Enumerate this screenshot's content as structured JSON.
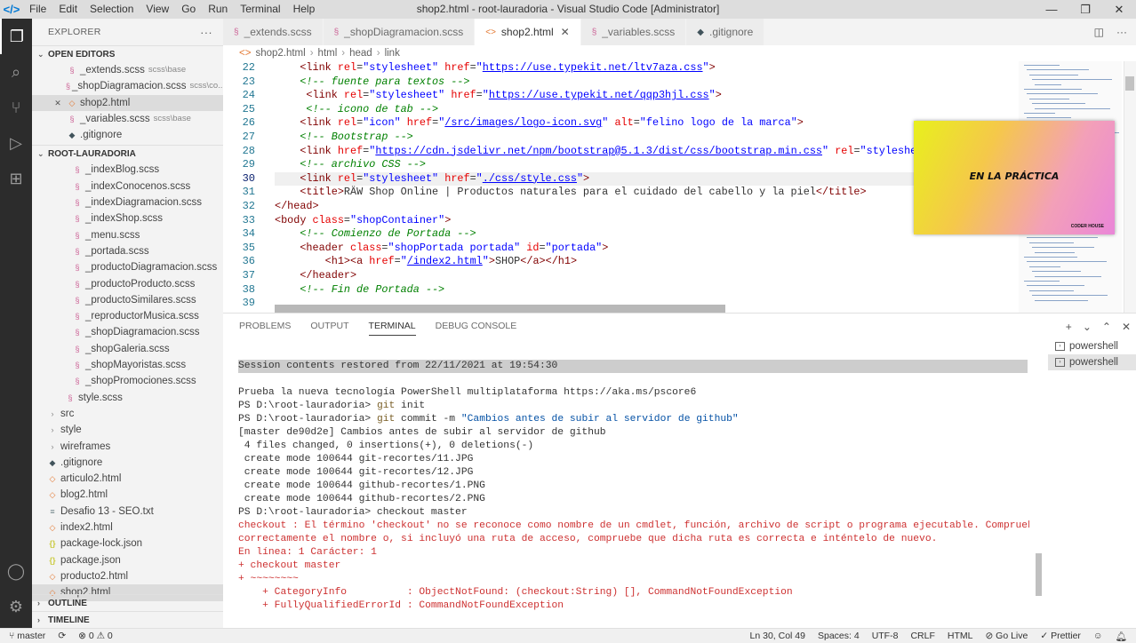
{
  "titlebar": {
    "menu": [
      "File",
      "Edit",
      "Selection",
      "View",
      "Go",
      "Run",
      "Terminal",
      "Help"
    ],
    "title": "shop2.html - root-lauradoria - Visual Studio Code [Administrator]"
  },
  "sidebar": {
    "title": "EXPLORER",
    "open_editors_label": "OPEN EDITORS",
    "open_editors": [
      {
        "name": "_extends.scss",
        "hint": "scss\\base"
      },
      {
        "name": "_shopDiagramacion.scss",
        "hint": "scss\\co..."
      },
      {
        "name": "shop2.html",
        "hint": ""
      },
      {
        "name": "_variables.scss",
        "hint": "scss\\base"
      },
      {
        "name": ".gitignore",
        "hint": ""
      }
    ],
    "root_label": "ROOT-LAURADORIA",
    "files": [
      "_indexBlog.scss",
      "_indexConocenos.scss",
      "_indexDiagramacion.scss",
      "_indexShop.scss",
      "_menu.scss",
      "_portada.scss",
      "_productoDiagramacion.scss",
      "_productoProducto.scss",
      "_productoSimilares.scss",
      "_reproductorMusica.scss",
      "_shopDiagramacion.scss",
      "_shopGaleria.scss",
      "_shopMayoristas.scss",
      "_shopPromociones.scss",
      "style.scss",
      "src",
      "style",
      "wireframes",
      ".gitignore",
      "articulo2.html",
      "blog2.html",
      "Desafio 13 - SEO.txt",
      "index2.html",
      "package-lock.json",
      "package.json",
      "producto2.html",
      "shop2.html"
    ],
    "outline_label": "OUTLINE",
    "timeline_label": "TIMELINE"
  },
  "tabs": [
    {
      "label": "_extends.scss"
    },
    {
      "label": "_shopDiagramacion.scss"
    },
    {
      "label": "shop2.html"
    },
    {
      "label": "_variables.scss"
    },
    {
      "label": ".gitignore"
    }
  ],
  "breadcrumb": [
    "shop2.html",
    "html",
    "head",
    "link"
  ],
  "editor": {
    "line_numbers": [
      "22",
      "23",
      "24",
      "25",
      "26",
      "27",
      "28",
      "29",
      "30",
      "31",
      "32",
      "33",
      "34",
      "35",
      "36",
      "37",
      "38",
      "39"
    ],
    "lines": [
      "    <link rel=\"stylesheet\" href=\"https://use.typekit.net/ltv7aza.css\">",
      "    <!-- fuente para textos -->",
      "     <link rel=\"stylesheet\" href=\"https://use.typekit.net/qqp3hjl.css\">",
      "     <!-- icono de tab -->",
      "    <link rel=\"icon\" href=\"/src/images/logo-icon.svg\" alt=\"felino logo de la marca\">",
      "    <!-- Bootstrap -->",
      "    <link href=\"https://cdn.jsdelivr.net/npm/bootstrap@5.1.3/dist/css/bootstrap.min.css\" rel=\"stylesheet\" integri",
      "    <!-- archivo CSS -->",
      "    <link rel=\"stylesheet\" href=\"./css/style.css\">",
      "    <title>RÄW Shop Online | Productos naturales para el cuidado del cabello y la piel</title>",
      "</head>",
      "<body class=\"shopContainer\">",
      "    <!-- Comienzo de Portada -->",
      "    <header class=\"shopPortada portada\" id=\"portada\">",
      "        <h1><a href=\"/index2.html\">SHOP</a></h1>",
      "    </header>",
      "    <!-- Fin de Portada -->",
      ""
    ]
  },
  "overlay": {
    "title": "EN LA PRÁCTICA",
    "tag": "CODER HOUSE"
  },
  "panel": {
    "tabs": [
      "PROBLEMS",
      "OUTPUT",
      "TERMINAL",
      "DEBUG CONSOLE"
    ],
    "shells": [
      "powershell",
      "powershell"
    ],
    "terminal": [
      "Session contents restored from 22/11/2021 at 19:54:30",
      "",
      "Prueba la nueva tecnología PowerShell multiplataforma https://aka.ms/pscore6",
      "PS D:\\root-lauradoria> git init",
      "PS D:\\root-lauradoria> git commit -m \"Cambios antes de subir al servidor de github\"",
      "[master de90d2e] Cambios antes de subir al servidor de github",
      " 4 files changed, 0 insertions(+), 0 deletions(-)",
      " create mode 100644 git-recortes/11.JPG",
      " create mode 100644 git-recortes/12.JPG",
      " create mode 100644 github-recortes/1.PNG",
      " create mode 100644 github-recortes/2.PNG",
      "PS D:\\root-lauradoria> checkout master",
      "checkout : El término 'checkout' no se reconoce como nombre de un cmdlet, función, archivo de script o programa ejecutable. Compruebe si escribió",
      "correctamente el nombre o, si incluyó una ruta de acceso, compruebe que dicha ruta es correcta e inténtelo de nuevo.",
      "En línea: 1 Carácter: 1",
      "+ checkout master",
      "+ ~~~~~~~~",
      "    + CategoryInfo          : ObjectNotFound: (checkout:String) [], CommandNotFoundException",
      "    + FullyQualifiedErrorId : CommandNotFoundException"
    ]
  },
  "statusbar": {
    "branch": "master",
    "problems": "⊗ 0 ⚠ 0",
    "position": "Ln 30, Col 49",
    "spaces": "Spaces: 4",
    "encoding": "UTF-8",
    "eol": "CRLF",
    "language": "HTML",
    "golive": "Go Live",
    "prettier": "✓ Prettier"
  }
}
